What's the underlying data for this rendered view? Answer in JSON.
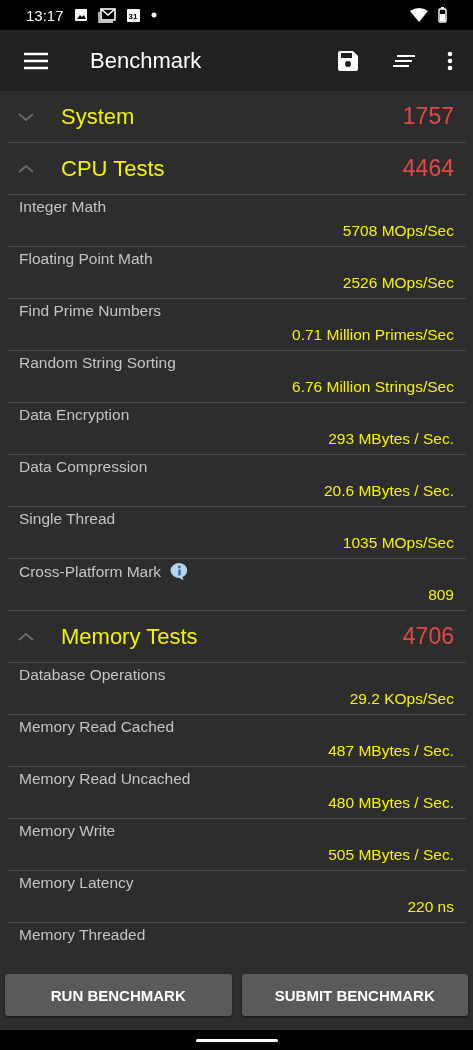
{
  "status_bar": {
    "time": "13:17",
    "calendar_day": "31"
  },
  "app_bar": {
    "title": "Benchmark"
  },
  "sections": [
    {
      "title": "System",
      "score": "1757",
      "expanded": false
    },
    {
      "title": "CPU Tests",
      "score": "4464",
      "expanded": true,
      "tests": [
        {
          "name": "Integer Math",
          "value": "5708 MOps/Sec"
        },
        {
          "name": "Floating Point Math",
          "value": "2526 MOps/Sec"
        },
        {
          "name": "Find Prime Numbers",
          "value": "0.71 Million Primes/Sec"
        },
        {
          "name": "Random String Sorting",
          "value": "6.76 Million Strings/Sec"
        },
        {
          "name": "Data Encryption",
          "value": "293 MBytes / Sec."
        },
        {
          "name": "Data Compression",
          "value": "20.6 MBytes / Sec."
        },
        {
          "name": "Single Thread",
          "value": "1035 MOps/Sec"
        },
        {
          "name": "Cross-Platform Mark",
          "value": "809",
          "info": true
        }
      ]
    },
    {
      "title": "Memory Tests",
      "score": "4706",
      "expanded": true,
      "tests": [
        {
          "name": "Database Operations",
          "value": "29.2 KOps/Sec"
        },
        {
          "name": "Memory Read Cached",
          "value": "487 MBytes / Sec."
        },
        {
          "name": "Memory Read Uncached",
          "value": "480 MBytes / Sec."
        },
        {
          "name": "Memory Write",
          "value": "505 MBytes / Sec."
        },
        {
          "name": "Memory Latency",
          "value": "220 ns"
        },
        {
          "name": "Memory Threaded"
        }
      ]
    }
  ],
  "buttons": [
    {
      "label": "RUN BENCHMARK"
    },
    {
      "label": "SUBMIT BENCHMARK"
    }
  ]
}
